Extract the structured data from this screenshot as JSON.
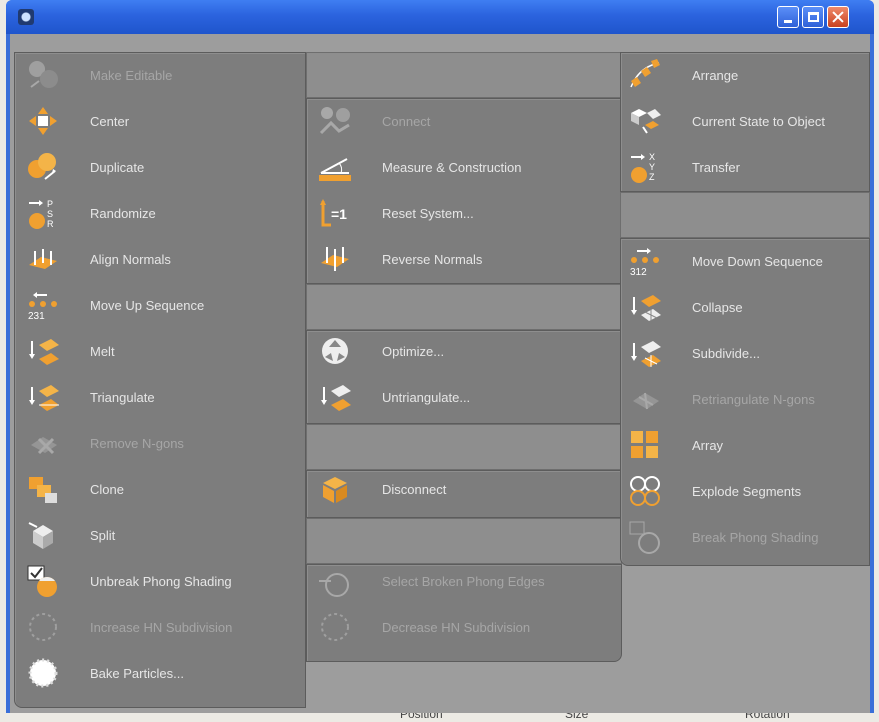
{
  "window": {
    "title": "",
    "colors": {
      "titlebar": "#2b63de",
      "panel": "#7d7d7d",
      "text": "#e6e6e6",
      "icon_orange": "#f0a030"
    }
  },
  "commands": {
    "make_editable": {
      "label": "Make Editable",
      "icon": "make-editable-icon"
    },
    "center": {
      "label": "Center",
      "icon": "center-icon"
    },
    "duplicate": {
      "label": "Duplicate",
      "icon": "duplicate-icon"
    },
    "randomize": {
      "label": "Randomize",
      "icon": "randomize-icon"
    },
    "align_normals": {
      "label": "Align Normals",
      "icon": "align-normals-icon"
    },
    "move_up_sequence": {
      "label": "Move Up Sequence",
      "icon": "move-up-sequence-icon"
    },
    "melt": {
      "label": "Melt",
      "icon": "melt-icon"
    },
    "triangulate": {
      "label": "Triangulate",
      "icon": "triangulate-icon"
    },
    "remove_ngons": {
      "label": "Remove N-gons",
      "icon": "remove-ngons-icon"
    },
    "clone": {
      "label": "Clone",
      "icon": "clone-icon"
    },
    "split": {
      "label": "Split",
      "icon": "split-icon"
    },
    "unbreak_phong": {
      "label": "Unbreak Phong Shading",
      "icon": "unbreak-phong-icon"
    },
    "increase_hn": {
      "label": "Increase HN Subdivision",
      "icon": "increase-hn-icon"
    },
    "bake_particles": {
      "label": "Bake Particles...",
      "icon": "bake-particles-icon"
    },
    "connect": {
      "label": "Connect",
      "icon": "connect-icon"
    },
    "measure": {
      "label": "Measure & Construction",
      "icon": "measure-icon"
    },
    "reset_system": {
      "label": "Reset System...",
      "icon": "reset-system-icon"
    },
    "reverse_normals": {
      "label": "Reverse Normals",
      "icon": "reverse-normals-icon"
    },
    "optimize": {
      "label": "Optimize...",
      "icon": "optimize-icon"
    },
    "untriangulate": {
      "label": "Untriangulate...",
      "icon": "untriangulate-icon"
    },
    "disconnect": {
      "label": "Disconnect",
      "icon": "disconnect-icon"
    },
    "select_broken_phong": {
      "label": "Select Broken Phong Edges",
      "icon": "select-broken-phong-icon"
    },
    "decrease_hn": {
      "label": "Decrease HN Subdivision",
      "icon": "decrease-hn-icon"
    },
    "arrange": {
      "label": "Arrange",
      "icon": "arrange-icon"
    },
    "current_state": {
      "label": "Current State to Object",
      "icon": "current-state-icon"
    },
    "transfer": {
      "label": "Transfer",
      "icon": "transfer-icon"
    },
    "move_down_sequence": {
      "label": "Move Down Sequence",
      "icon": "move-down-sequence-icon"
    },
    "collapse": {
      "label": "Collapse",
      "icon": "collapse-icon"
    },
    "subdivide": {
      "label": "Subdivide...",
      "icon": "subdivide-icon"
    },
    "retriangulate_ngons": {
      "label": "Retriangulate N-gons",
      "icon": "retriangulate-ngons-icon"
    },
    "array": {
      "label": "Array",
      "icon": "array-icon"
    },
    "explode_segments": {
      "label": "Explode Segments",
      "icon": "explode-segments-icon"
    },
    "break_phong": {
      "label": "Break Phong Shading",
      "icon": "break-phong-icon"
    }
  },
  "background_strip": {
    "col1": "Position",
    "col2": "Size",
    "col3": "Rotation"
  }
}
